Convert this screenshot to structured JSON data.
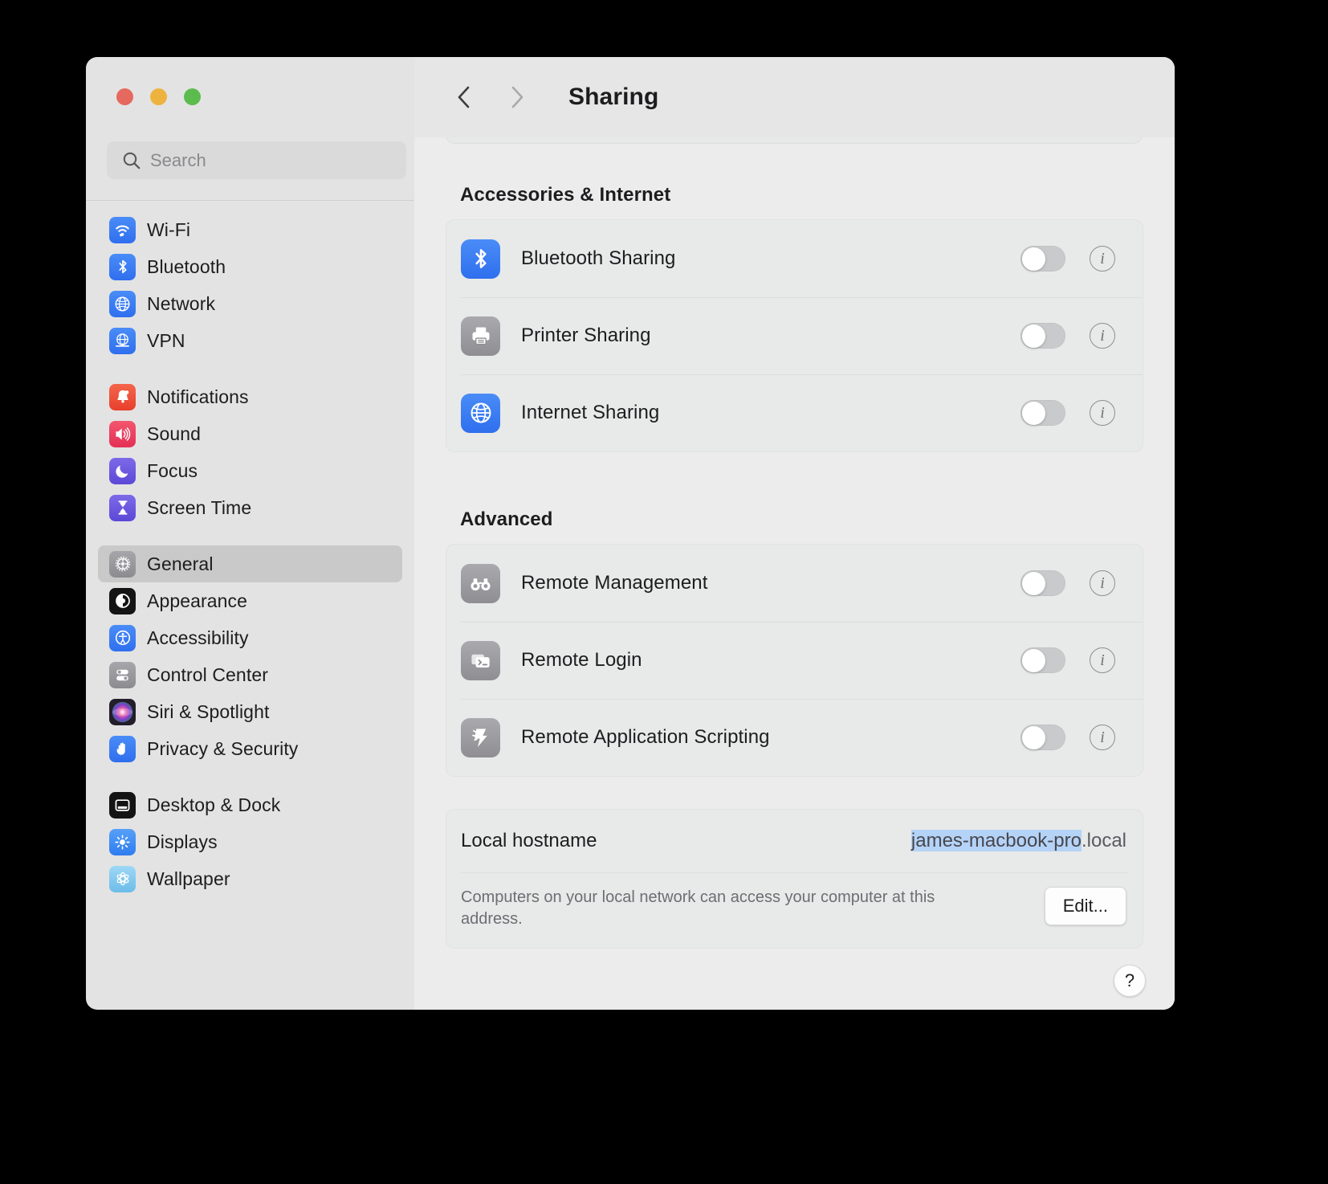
{
  "window": {
    "traffic_lights": [
      {
        "name": "close",
        "color": "#e5695f"
      },
      {
        "name": "minimize",
        "color": "#eeb33f"
      },
      {
        "name": "zoom",
        "color": "#5cbb4d"
      }
    ]
  },
  "sidebar": {
    "search": {
      "value": "",
      "placeholder": "Search"
    },
    "groups": [
      {
        "items": [
          {
            "label": "Wi-Fi",
            "icon": "wifi-icon",
            "color": "#3b7df4",
            "selected": false
          },
          {
            "label": "Bluetooth",
            "icon": "bluetooth-icon",
            "color": "#3b7df4",
            "selected": false
          },
          {
            "label": "Network",
            "icon": "globe-icon",
            "color": "#3b7df4",
            "selected": false
          },
          {
            "label": "VPN",
            "icon": "vpn-globe-icon",
            "color": "#3b7df4",
            "selected": false
          }
        ]
      },
      {
        "items": [
          {
            "label": "Notifications",
            "icon": "bell-icon",
            "color": "#ef4e3a",
            "selected": false
          },
          {
            "label": "Sound",
            "icon": "speaker-icon",
            "color": "#ee4061",
            "selected": false
          },
          {
            "label": "Focus",
            "icon": "moon-icon",
            "color": "#6a5be0",
            "selected": false
          },
          {
            "label": "Screen Time",
            "icon": "hourglass-icon",
            "color": "#6a5be0",
            "selected": false
          }
        ]
      },
      {
        "items": [
          {
            "label": "General",
            "icon": "gear-icon",
            "color": "#8e8e93",
            "selected": true
          },
          {
            "label": "Appearance",
            "icon": "appearance-icon",
            "color": "#141414",
            "selected": false
          },
          {
            "label": "Accessibility",
            "icon": "accessibility-icon",
            "color": "#2f7cf6",
            "selected": false
          },
          {
            "label": "Control Center",
            "icon": "control-center-icon",
            "color": "#8e8e93",
            "selected": false
          },
          {
            "label": "Siri & Spotlight",
            "icon": "siri-icon",
            "color": "#2b2330",
            "selected": false
          },
          {
            "label": "Privacy & Security",
            "icon": "hand-icon",
            "color": "#2f7cf6",
            "selected": false
          }
        ]
      },
      {
        "items": [
          {
            "label": "Desktop & Dock",
            "icon": "desktop-dock-icon",
            "color": "#141414",
            "selected": false
          },
          {
            "label": "Displays",
            "icon": "brightness-icon",
            "color": "#3b8bf4",
            "selected": false
          },
          {
            "label": "Wallpaper",
            "icon": "wallpaper-icon",
            "color": "#7fc5ef",
            "selected": false
          }
        ]
      }
    ]
  },
  "toolbar": {
    "back_label": "Back",
    "forward_label": "Forward",
    "title": "Sharing",
    "back_enabled": true,
    "forward_enabled": false
  },
  "main": {
    "sections": [
      {
        "title": "Accessories & Internet",
        "rows": [
          {
            "label": "Bluetooth Sharing",
            "icon": "bluetooth-icon",
            "color": "#3b7df4",
            "toggle": "off",
            "info": "i"
          },
          {
            "label": "Printer Sharing",
            "icon": "printer-icon",
            "color": "#8e8e93",
            "toggle": "off",
            "info": "i"
          },
          {
            "label": "Internet Sharing",
            "icon": "globe-icon",
            "color": "#3b7df4",
            "toggle": "off",
            "info": "i"
          }
        ]
      },
      {
        "title": "Advanced",
        "rows": [
          {
            "label": "Remote Management",
            "icon": "binoculars-icon",
            "color": "#9a9a9f",
            "toggle": "off",
            "info": "i"
          },
          {
            "label": "Remote Login",
            "icon": "terminal-icon",
            "color": "#9a9a9f",
            "toggle": "off",
            "info": "i"
          },
          {
            "label": "Remote Application Scripting",
            "icon": "script-icon",
            "color": "#9a9a9f",
            "toggle": "off",
            "info": "i"
          }
        ]
      }
    ],
    "hostname": {
      "label": "Local hostname",
      "value_selected": "james-macbook-pro",
      "value_rest": ".local",
      "description": "Computers on your local network can access your computer at this address.",
      "edit_label": "Edit..."
    },
    "help_label": "?"
  },
  "colors": {
    "window_bg": "#ececec",
    "sidebar_bg": "#e3e3e3",
    "card_bg": "#e8e9e9",
    "selection_blue": "#b5d3f7",
    "accent_blue": "#3b7df4"
  }
}
